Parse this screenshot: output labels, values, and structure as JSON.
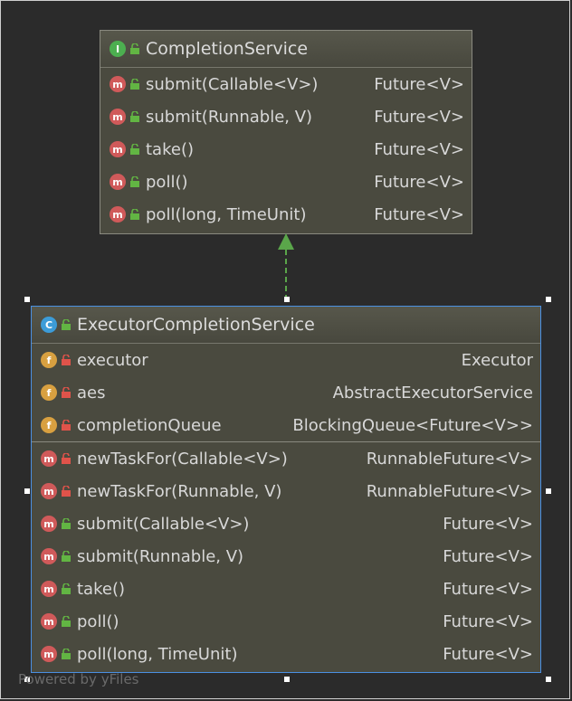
{
  "interface": {
    "badge": "I",
    "name": "CompletionService",
    "methods": [
      {
        "badge": "m",
        "name": "submit(Callable<V>)",
        "type": "Future<V>"
      },
      {
        "badge": "m",
        "name": "submit(Runnable, V)",
        "type": "Future<V>"
      },
      {
        "badge": "m",
        "name": "take()",
        "type": "Future<V>"
      },
      {
        "badge": "m",
        "name": "poll()",
        "type": "Future<V>"
      },
      {
        "badge": "m",
        "name": "poll(long, TimeUnit)",
        "type": "Future<V>"
      }
    ]
  },
  "class": {
    "badge": "C",
    "name": "ExecutorCompletionService",
    "fields": [
      {
        "badge": "f",
        "name": "executor",
        "type": "Executor"
      },
      {
        "badge": "f",
        "name": "aes",
        "type": "AbstractExecutorService"
      },
      {
        "badge": "f",
        "name": "completionQueue",
        "type": "BlockingQueue<Future<V>>"
      }
    ],
    "methods": [
      {
        "badge": "m",
        "name": "newTaskFor(Callable<V>)",
        "type": "RunnableFuture<V>"
      },
      {
        "badge": "m",
        "name": "newTaskFor(Runnable, V)",
        "type": "RunnableFuture<V>"
      },
      {
        "badge": "m",
        "name": "submit(Callable<V>)",
        "type": "Future<V>"
      },
      {
        "badge": "m",
        "name": "submit(Runnable, V)",
        "type": "Future<V>"
      },
      {
        "badge": "m",
        "name": "take()",
        "type": "Future<V>"
      },
      {
        "badge": "m",
        "name": "poll()",
        "type": "Future<V>"
      },
      {
        "badge": "m",
        "name": "poll(long, TimeUnit)",
        "type": "Future<V>"
      }
    ]
  },
  "watermark": "Powered by yFiles",
  "colors": {
    "arrow": "#5aa64a",
    "selection": "#4a90e2",
    "lock_public": "#62b543",
    "lock_private": "#e0534a"
  }
}
